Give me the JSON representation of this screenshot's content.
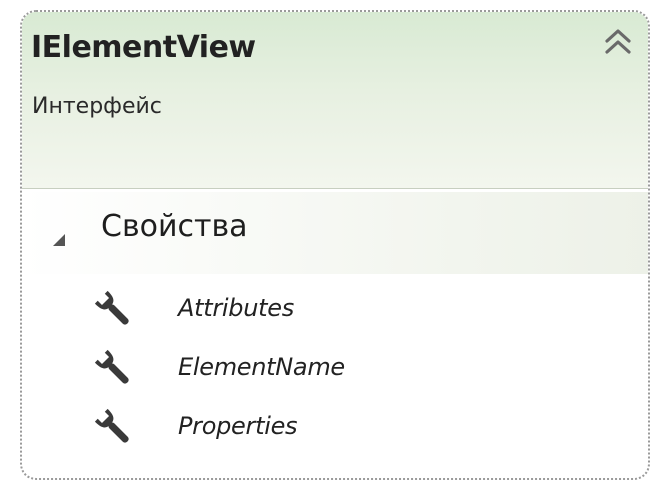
{
  "shape": {
    "title": "IElementView",
    "stereotype": "Интерфейс",
    "collapse_icon": "double-chevron-up-icon",
    "sections": [
      {
        "label": "Свойства",
        "expanded": true,
        "members": [
          {
            "name": "Attributes",
            "icon": "wrench-icon"
          },
          {
            "name": "ElementName",
            "icon": "wrench-icon"
          },
          {
            "name": "Properties",
            "icon": "wrench-icon"
          }
        ]
      }
    ]
  },
  "colors": {
    "header_green": "#d8ead3",
    "border": "#9a9a9a",
    "text": "#222222",
    "icon": "#3a3a3a"
  }
}
